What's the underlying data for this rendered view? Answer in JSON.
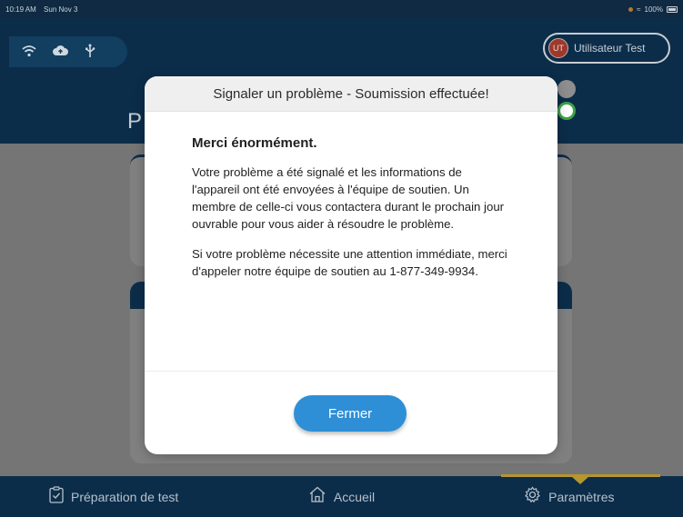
{
  "status_bar": {
    "time": "10:19 AM",
    "date": "Sun Nov 3",
    "battery": "100%"
  },
  "header": {
    "icons": [
      "wifi-icon",
      "cloud-upload-icon",
      "usb-icon"
    ],
    "user": {
      "initials": "UT",
      "name": "Utilisateur Test"
    },
    "page_title_partial": "P"
  },
  "modal": {
    "title": "Signaler un problème - Soumission effectuée!",
    "heading": "Merci énormément.",
    "paragraph1": "Votre problème a été signalé et les informations de l'appareil ont été envoyées à l'équipe de soutien. Un membre de celle-ci vous contactera durant le prochain jour ouvrable pour vous aider à résoudre le problème.",
    "paragraph2": "Si votre problème nécessite une attention immédiate, merci d'appeler notre équipe de soutien au 1-877-349-9934.",
    "close_label": "Fermer"
  },
  "tabbar": {
    "tabs": [
      {
        "label": "Préparation de test",
        "icon": "clipboard-check-icon"
      },
      {
        "label": "Accueil",
        "icon": "home-icon"
      },
      {
        "label": "Paramètres",
        "icon": "gear-icon",
        "active": true
      }
    ]
  },
  "colors": {
    "primary_navy": "#0b2d4a",
    "accent_blue": "#2e8fd6",
    "active_gold": "#b5962f"
  }
}
